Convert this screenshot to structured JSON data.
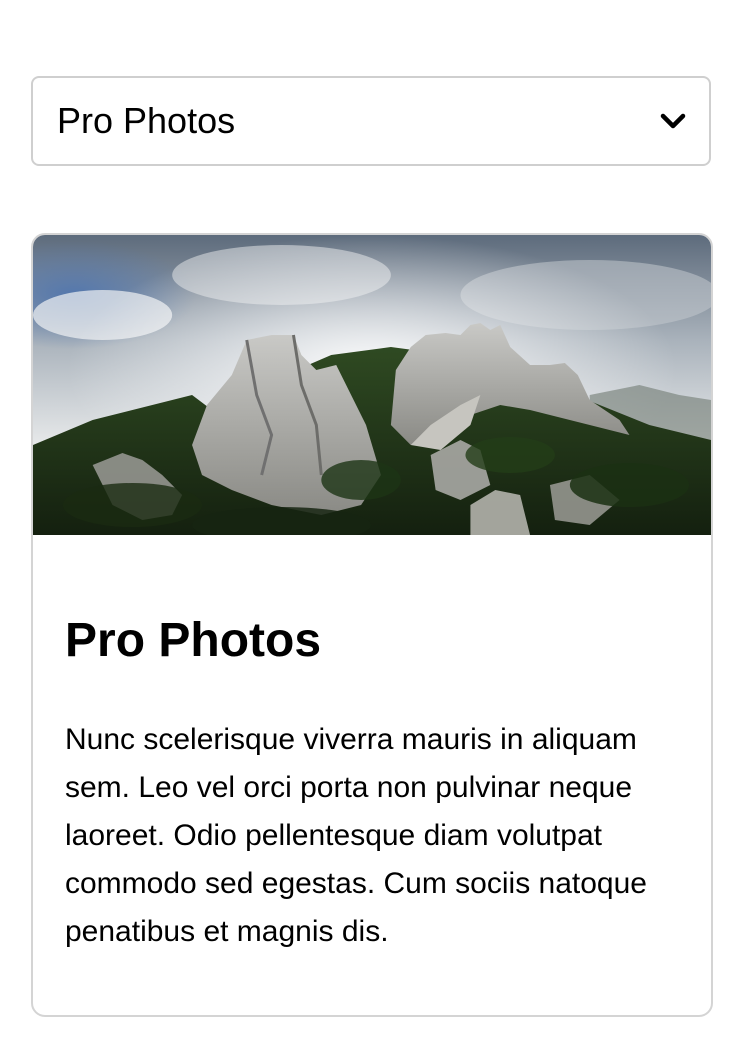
{
  "select": {
    "value": "Pro Photos"
  },
  "card": {
    "title": "Pro Photos",
    "text": "Nunc scelerisque viverra mauris in aliquam sem. Leo vel orci porta non pulvinar neque laoreet. Odio pellentesque diam volutpat commodo sed egestas. Cum sociis natoque penatibus et magnis dis."
  },
  "icons": {
    "dropdown": "chevron-down-icon"
  },
  "colors": {
    "border": "#cfcfcf",
    "text": "#000000"
  }
}
